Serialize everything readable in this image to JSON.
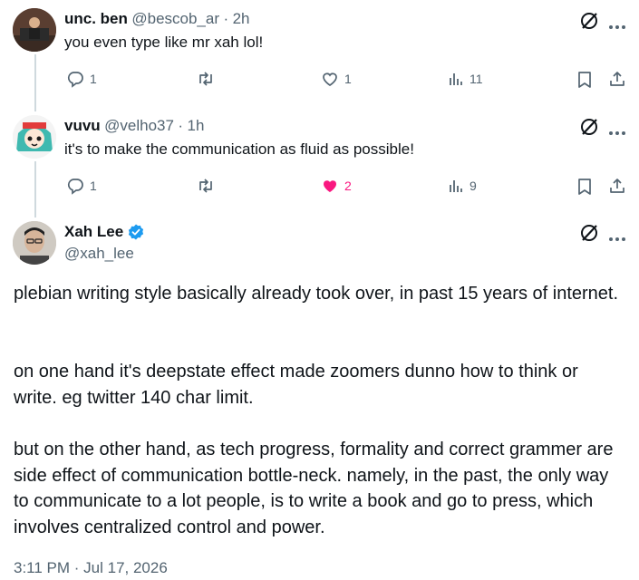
{
  "replies": [
    {
      "name": "unc. ben",
      "handle": "@bescob_ar",
      "time": "2h",
      "text": "you even type like mr xah lol!",
      "replies": "1",
      "retweets": "",
      "likes": "1",
      "liked": false,
      "views": "11"
    },
    {
      "name": "vuvu",
      "handle": "@velho37",
      "time": "1h",
      "text": "it's to make the communication as fluid as possible!",
      "replies": "1",
      "retweets": "",
      "likes": "2",
      "liked": true,
      "views": "9"
    }
  ],
  "main": {
    "name": "Xah Lee",
    "handle": "@xah_lee",
    "verified": true,
    "paragraphs": [
      "plebian writing style basically already took over, in past 15 years of internet.",
      "on one hand it's deepstate effect made zoomers dunno how to think or write. eg twitter 140 char limit.",
      "but on the other hand, as tech progress, formality and correct grammer are side effect of communication bottle-neck. namely, in the past, the only way to communicate to a lot people, is to write a book and go to press, which involves centralized control and power."
    ],
    "timestamp": "3:11 PM · Jul 17, 2026"
  },
  "colors": {
    "like_active": "#f91880",
    "verified": "#1d9bf0",
    "muted": "#536471",
    "text": "#0f1419"
  },
  "icons": [
    "reply-icon",
    "retweet-icon",
    "like-icon",
    "views-icon",
    "bookmark-icon",
    "share-icon",
    "grok-icon",
    "more-icon",
    "verified-badge-icon"
  ]
}
